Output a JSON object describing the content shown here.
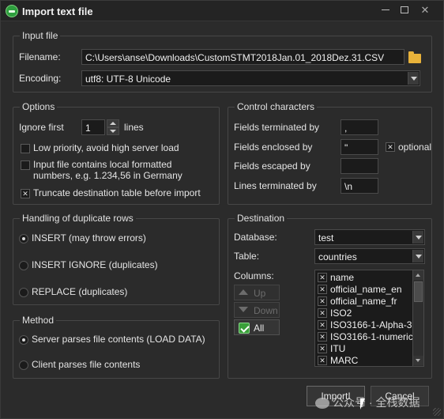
{
  "window": {
    "title": "Import text file"
  },
  "input_file": {
    "group_title": "Input file",
    "filename_label": "Filename:",
    "filename_value": "C:\\Users\\anse\\Downloads\\CustomSTMT2018Jan.01_2018Dez.31.CSV",
    "encoding_label": "Encoding:",
    "encoding_value": "utf8: UTF-8 Unicode"
  },
  "options": {
    "group_title": "Options",
    "ignore_first_label": "Ignore first",
    "ignore_first_value": "1",
    "ignore_first_unit": "lines",
    "low_priority_label": "Low priority, avoid high server load",
    "low_priority_checked": false,
    "local_numbers_label_line1": "Input file contains local formatted",
    "local_numbers_label_line2": "numbers, e.g. 1.234,56 in Germany",
    "local_numbers_checked": false,
    "truncate_label": "Truncate destination table before import",
    "truncate_checked": true
  },
  "control_characters": {
    "group_title": "Control characters",
    "fields_terminated_label": "Fields terminated by",
    "fields_terminated_value": ",",
    "fields_enclosed_label": "Fields enclosed by",
    "fields_enclosed_value": "\"",
    "optional_label": "optional",
    "optional_checked": true,
    "fields_escaped_label": "Fields escaped by",
    "fields_escaped_value": "",
    "lines_terminated_label": "Lines terminated by",
    "lines_terminated_value": "\\n"
  },
  "duplicates": {
    "group_title": "Handling of duplicate rows",
    "options": [
      {
        "label": "INSERT (may throw errors)",
        "checked": true
      },
      {
        "label": "INSERT IGNORE (duplicates)",
        "checked": false
      },
      {
        "label": "REPLACE (duplicates)",
        "checked": false
      }
    ]
  },
  "method": {
    "group_title": "Method",
    "options": [
      {
        "label": "Server parses file contents (LOAD DATA)",
        "checked": true
      },
      {
        "label": "Client parses file contents",
        "checked": false
      }
    ]
  },
  "destination": {
    "group_title": "Destination",
    "database_label": "Database:",
    "database_value": "test",
    "table_label": "Table:",
    "table_value": "countries",
    "columns_label": "Columns:",
    "up_label": "Up",
    "down_label": "Down",
    "all_label": "All",
    "columns": [
      {
        "name": "name",
        "checked": true
      },
      {
        "name": "official_name_en",
        "checked": true
      },
      {
        "name": "official_name_fr",
        "checked": true
      },
      {
        "name": "ISO2",
        "checked": true
      },
      {
        "name": "ISO3166-1-Alpha-3",
        "checked": true
      },
      {
        "name": "ISO3166-1-numeric",
        "checked": true
      },
      {
        "name": "ITU",
        "checked": true
      },
      {
        "name": "MARC",
        "checked": true
      }
    ]
  },
  "footer": {
    "import_label": "Import!",
    "cancel_label": "Cancel"
  },
  "watermark": {
    "text": "公众号 · 全栈数据"
  },
  "colors": {
    "background": "#2b2b2b",
    "field_bg": "#1b1b1b",
    "folder": "#e8b23a",
    "all_check": "#3aa03a"
  }
}
